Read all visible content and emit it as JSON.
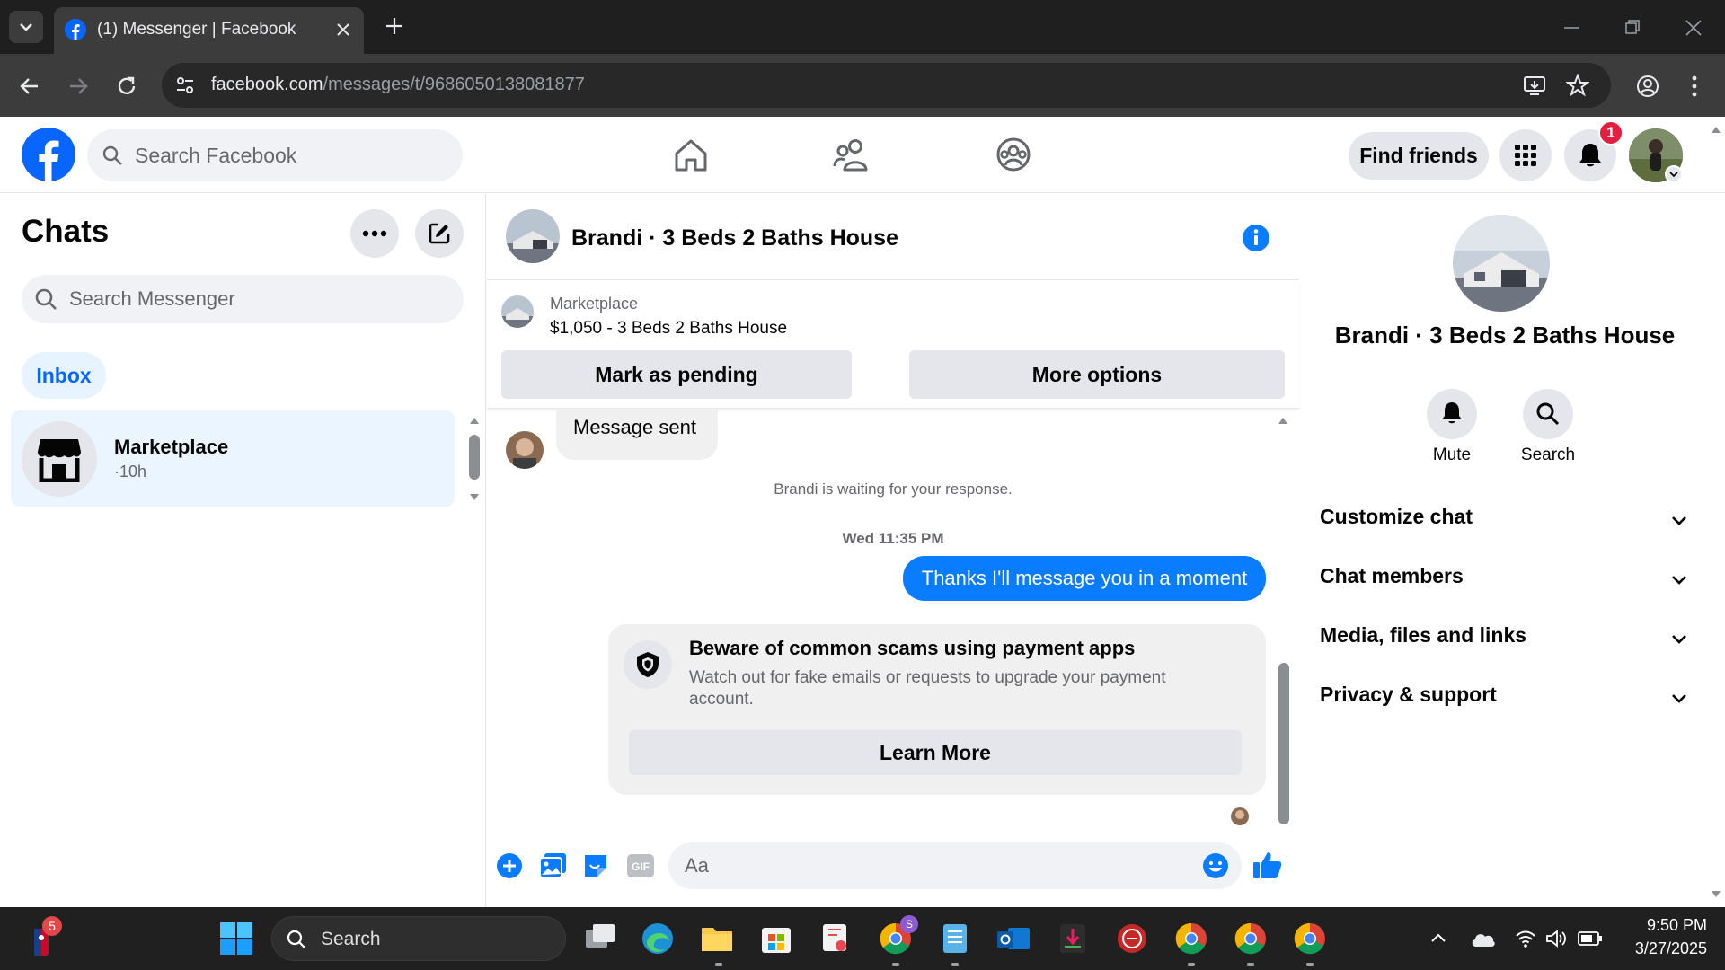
{
  "browser": {
    "tab_title": "(1) Messenger | Facebook",
    "url_host": "facebook.com",
    "url_path": "/messages/t/9686050138081877"
  },
  "fb": {
    "search_placeholder": "Search Facebook",
    "find_friends": "Find friends",
    "notification_count": "1"
  },
  "left": {
    "title": "Chats",
    "search_placeholder": "Search Messenger",
    "inbox": "Inbox",
    "chat": {
      "name": "Marketplace",
      "time": "·10h"
    }
  },
  "conversation": {
    "title": "Brandi · 3 Beds 2 Baths House",
    "market_label": "Marketplace",
    "listing": "$1,050 - 3 Beds 2 Baths House",
    "mark_pending": "Mark as pending",
    "more_options": "More options",
    "message_in": "Message sent",
    "waiting": "Brandi is waiting for your response.",
    "timestamp": "Wed 11:35 PM",
    "message_out": "Thanks I'll message you in a moment",
    "scam_title": "Beware of common scams using payment apps",
    "scam_body": "Watch out for fake emails or requests to upgrade your payment account.",
    "learn_more": "Learn More",
    "composer_placeholder": "Aa"
  },
  "right": {
    "title": "Brandi · 3 Beds 2 Baths House",
    "mute": "Mute",
    "search": "Search",
    "sections": [
      "Customize chat",
      "Chat members",
      "Media, files and links",
      "Privacy & support"
    ]
  },
  "taskbar": {
    "search": "Search",
    "badge": "5",
    "time": "9:50 PM",
    "date": "3/27/2025"
  },
  "colors": {
    "fb_blue": "#0866ff",
    "messenger_blue": "#0a7cff",
    "notification_red": "#e41e3f"
  }
}
